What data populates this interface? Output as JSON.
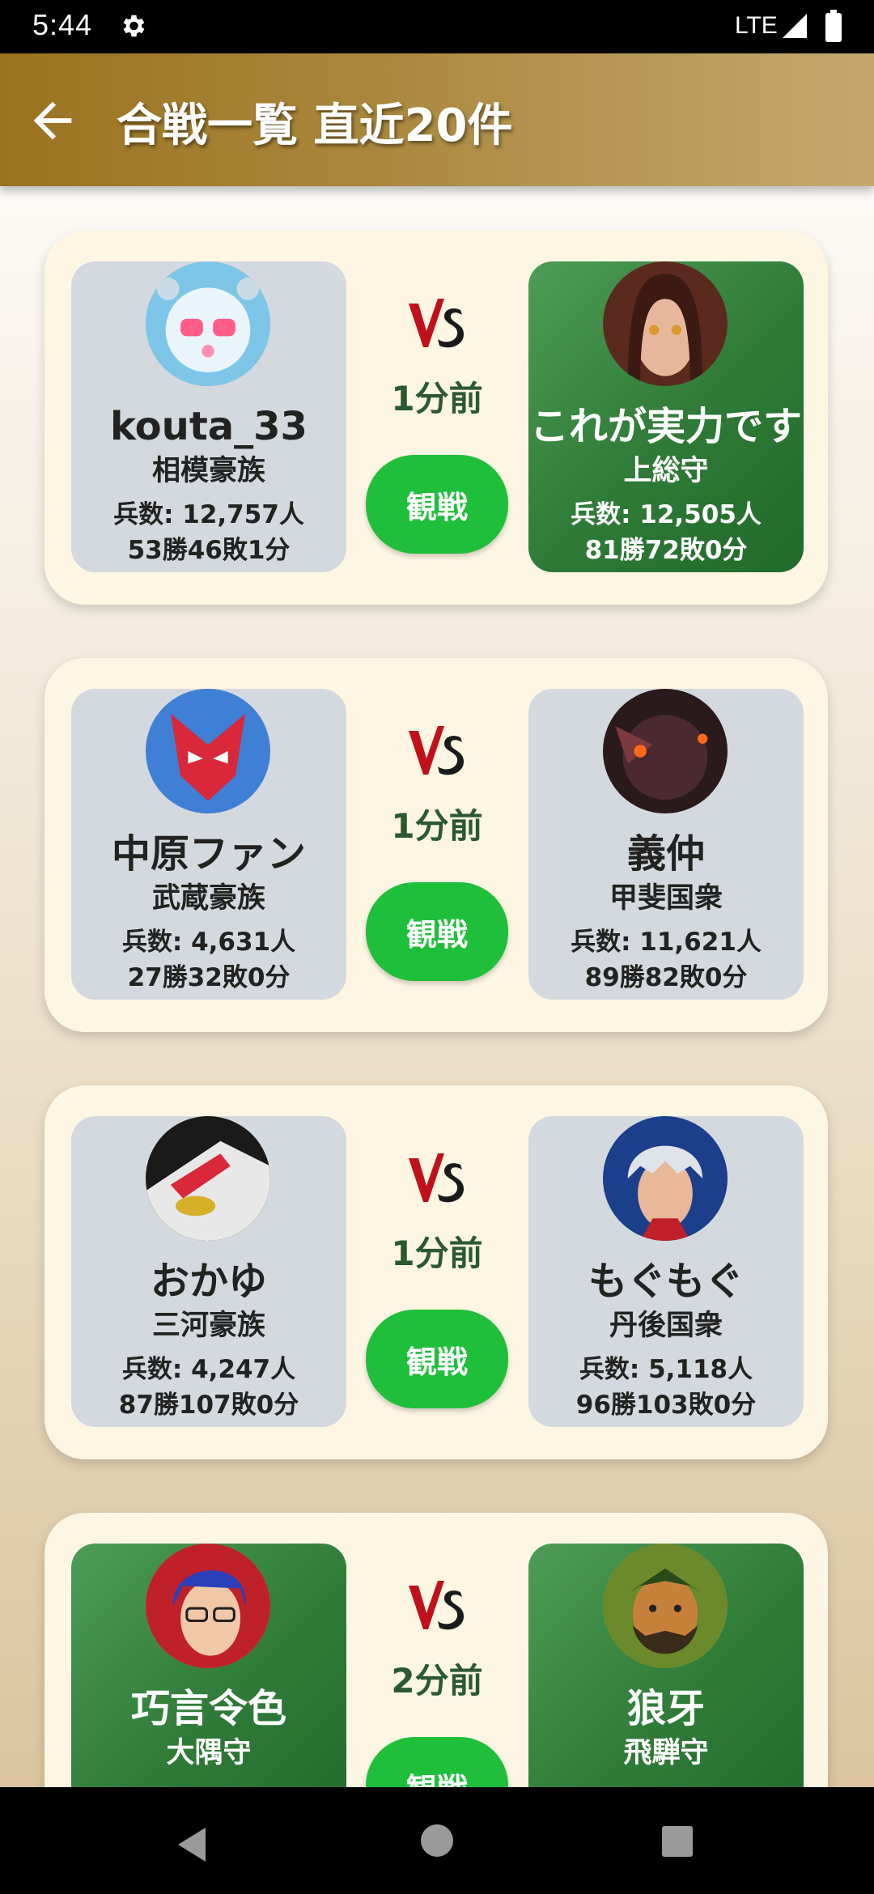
{
  "status_bar": {
    "time": "5:44",
    "network": "LTE"
  },
  "app_bar": {
    "title": "合戦一覧 直近20件"
  },
  "battles": [
    {
      "time_ago": "1分前",
      "watch_label": "観戦",
      "left": {
        "name": "kouta_33",
        "rank": "相模豪族",
        "troops": "兵数: 12,757人",
        "record": "53勝46敗1分",
        "winner": false
      },
      "right": {
        "name": "これが実力です",
        "rank": "上総守",
        "troops": "兵数: 12,505人",
        "record": "81勝72敗0分",
        "winner": true
      }
    },
    {
      "time_ago": "1分前",
      "watch_label": "観戦",
      "left": {
        "name": "中原ファン",
        "rank": "武蔵豪族",
        "troops": "兵数: 4,631人",
        "record": "27勝32敗0分",
        "winner": false
      },
      "right": {
        "name": "義仲",
        "rank": "甲斐国衆",
        "troops": "兵数: 11,621人",
        "record": "89勝82敗0分",
        "winner": false
      }
    },
    {
      "time_ago": "1分前",
      "watch_label": "観戦",
      "left": {
        "name": "おかゆ",
        "rank": "三河豪族",
        "troops": "兵数: 4,247人",
        "record": "87勝107敗0分",
        "winner": false
      },
      "right": {
        "name": "もぐもぐ",
        "rank": "丹後国衆",
        "troops": "兵数: 5,118人",
        "record": "96勝103敗0分",
        "winner": false
      }
    },
    {
      "time_ago": "2分前",
      "watch_label": "観戦",
      "left": {
        "name": "巧言令色",
        "rank": "大隅守",
        "winner": true
      },
      "right": {
        "name": "狼牙",
        "rank": "飛騨守",
        "winner": true
      }
    }
  ],
  "colors": {
    "app_bar": "#a9863a",
    "card": "#fdf6e3",
    "winner": "#2e7a36",
    "watch_button": "#1fbf3b",
    "player_bg": "#d3d9de"
  }
}
